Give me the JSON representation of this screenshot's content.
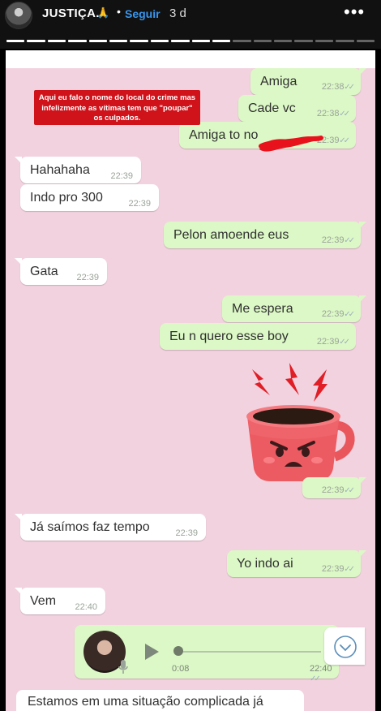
{
  "story": {
    "username": "JUSTIÇA.",
    "emoji": "🙏",
    "separator": "•",
    "follow_label": "Seguir",
    "time_ago": "3 d",
    "more_icon": "more-horizontal-icon",
    "segments_total": 18,
    "segments_viewed": 11
  },
  "note": {
    "text": "Aqui eu falo o nome do local do crime mas infelizmente as vítimas tem que \"poupar\" os culpados."
  },
  "messages": [
    {
      "dir": "out",
      "text": "Amiga",
      "time": "22:38"
    },
    {
      "dir": "out",
      "text": "Cade vc",
      "time": "22:38"
    },
    {
      "dir": "out",
      "text": "Amiga to no",
      "time": "22:39"
    },
    {
      "dir": "in",
      "text": "Hahahaha",
      "time": "22:39"
    },
    {
      "dir": "in",
      "text": "Indo pro 300",
      "time": "22:39"
    },
    {
      "dir": "out",
      "text": "Pelon amoende eus",
      "time": "22:39"
    },
    {
      "dir": "in",
      "text": "Gata",
      "time": "22:39"
    },
    {
      "dir": "out",
      "text": "Me espera",
      "time": "22:39"
    },
    {
      "dir": "out",
      "text": "Eu n quero esse boy",
      "time": "22:39"
    },
    {
      "dir": "out",
      "text": "",
      "time": "22:39"
    },
    {
      "dir": "in",
      "text": "Já saímos faz tempo",
      "time": "22:39"
    },
    {
      "dir": "out",
      "text": "Yo indo ai",
      "time": "22:39"
    },
    {
      "dir": "in",
      "text": "Vem",
      "time": "22:40"
    }
  ],
  "voice_message": {
    "duration": "0:08",
    "time": "22:40"
  },
  "cut_message": {
    "text": "Estamos em uma situação complicada já"
  },
  "colors": {
    "chat_bg": "#f2d2df",
    "outgoing": "#dcf8c6",
    "incoming": "#ffffff",
    "note_bg": "#d0121a",
    "follow": "#3897f0"
  }
}
